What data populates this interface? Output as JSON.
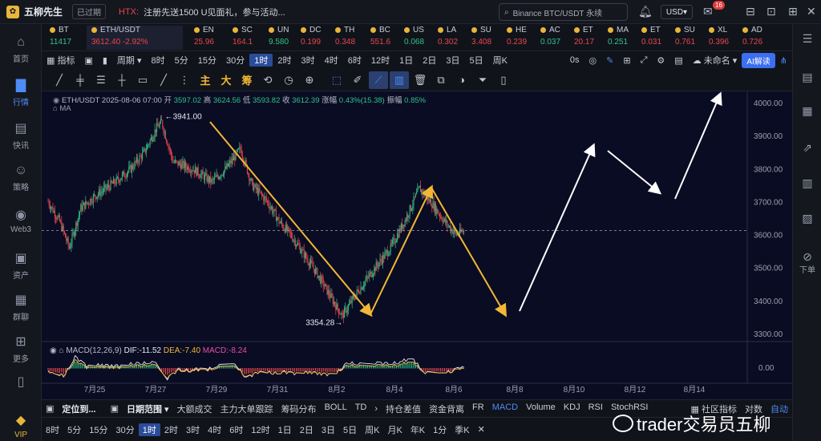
{
  "titlebar": {
    "app_name": "五柳先生",
    "expired_label": "已过期",
    "news_prefix": "HTX:",
    "news_text": "注册先送1500 U见面礼，参与活动...",
    "search_text": "Binance BTC/USDT 永续",
    "currency": "USD",
    "notify_count": "16"
  },
  "leftnav": {
    "items": [
      {
        "label": "首页"
      },
      {
        "label": "行情"
      },
      {
        "label": "快讯"
      },
      {
        "label": "策略"
      },
      {
        "label": "Web3"
      },
      {
        "label": "资产"
      },
      {
        "label": "群聊"
      },
      {
        "label": "更多"
      },
      {
        "label": "VIP"
      }
    ]
  },
  "rightnav": {
    "down_label": "下单"
  },
  "tickers": [
    {
      "sym": "BT",
      "val": "11417",
      "dir": "up"
    },
    {
      "sym": "ETH/USDT",
      "val": "3612.40",
      "chg": "-2.92%",
      "dir": "dn"
    },
    {
      "sym": "EN",
      "val": "25.96",
      "dir": "dn"
    },
    {
      "sym": "SC",
      "val": "164.1",
      "dir": "dn"
    },
    {
      "sym": "UN",
      "val": "9.580",
      "dir": "up"
    },
    {
      "sym": "DC",
      "val": "0.199",
      "dir": "dn"
    },
    {
      "sym": "TH",
      "val": "0.348",
      "dir": "dn"
    },
    {
      "sym": "BC",
      "val": "551.6",
      "dir": "dn"
    },
    {
      "sym": "US",
      "val": "0.068",
      "dir": "up"
    },
    {
      "sym": "LA",
      "val": "0.302",
      "dir": "dn"
    },
    {
      "sym": "SU",
      "val": "3.408",
      "dir": "dn"
    },
    {
      "sym": "HE",
      "val": "0.239",
      "dir": "dn"
    },
    {
      "sym": "AC",
      "val": "0.037",
      "dir": "up"
    },
    {
      "sym": "ET",
      "val": "20.17",
      "dir": "dn"
    },
    {
      "sym": "MA",
      "val": "0.251",
      "dir": "up"
    },
    {
      "sym": "ET",
      "val": "0.031",
      "dir": "dn"
    },
    {
      "sym": "SU",
      "val": "0.761",
      "dir": "dn"
    },
    {
      "sym": "XL",
      "val": "0.396",
      "dir": "dn"
    },
    {
      "sym": "AD",
      "val": "0.726",
      "dir": "dn"
    }
  ],
  "toolbar1": {
    "indicators": "指标",
    "period": "周期",
    "intervals": [
      "8时",
      "5分",
      "15分",
      "30分",
      "1时",
      "2时",
      "3时",
      "4时",
      "6时",
      "12时",
      "1日",
      "2日",
      "3日",
      "5日",
      "周K"
    ],
    "active_interval": "1时",
    "zero_s": "0s",
    "unnamed": "未命名",
    "ai_btn": "AI解读"
  },
  "toolbar2": {
    "tools": [
      "主",
      "大",
      "筹"
    ]
  },
  "chart_info": {
    "pair": "ETH/USDT",
    "datetime": "2025-08-06 07:00",
    "open_label": "开",
    "open": "3597.02",
    "high_label": "高",
    "high": "3624.56",
    "low_label": "低",
    "low": "3593.82",
    "close_label": "收",
    "close": "3612.39",
    "chg_label": "涨幅",
    "chg": "0.43%(15.38)",
    "amp_label": "振幅",
    "amp": "0.85%",
    "ma_label": "MA",
    "macd_params": "MACD(12,26,9)",
    "dif": "DIF:-11.52",
    "dea": "DEA:-7.40",
    "macd": "MACD:-8.24"
  },
  "annotations": {
    "high_label": "3941.00",
    "low_label": "3354.28"
  },
  "chart_data": {
    "type": "candlestick",
    "price_axis": [
      "4000.00",
      "3900.00",
      "3800.00",
      "3700.00",
      "3600.00",
      "3500.00",
      "3400.00",
      "3300.00"
    ],
    "macd_axis": "0.00",
    "x_labels": [
      "7月25",
      "7月27",
      "7月29",
      "7月31",
      "8月2",
      "8月4",
      "8月6",
      "8月8",
      "8月10",
      "8月12",
      "8月14"
    ],
    "ylim": [
      3300,
      4000
    ],
    "key_prices": {
      "high": 3941.0,
      "low": 3354.28,
      "current": 3612.39
    }
  },
  "bottom1": {
    "locate": "定位到...",
    "range": "日期范围",
    "items": [
      "大额成交",
      "主力大单跟踪",
      "筹码分布",
      "BOLL",
      "TD"
    ],
    "items2": [
      "持仓差值",
      "资金背离",
      "FR",
      "MACD",
      "Volume",
      "KDJ",
      "RSI",
      "StochRSI"
    ],
    "community": "社区指标",
    "log": "对数",
    "auto": "自动"
  },
  "bottom2": {
    "intervals": [
      "8时",
      "5分",
      "15分",
      "30分",
      "1时",
      "2时",
      "3时",
      "4时",
      "6时",
      "12时",
      "1日",
      "2日",
      "3日",
      "5日",
      "周K",
      "月K",
      "年K",
      "1分",
      "季K"
    ],
    "active": "1时"
  },
  "watermark": "trader交易员五柳",
  "colors": {
    "accent": "#4d8cf5",
    "up": "#2ec487",
    "down": "#e8474c",
    "draw_yellow": "#f2b735"
  }
}
